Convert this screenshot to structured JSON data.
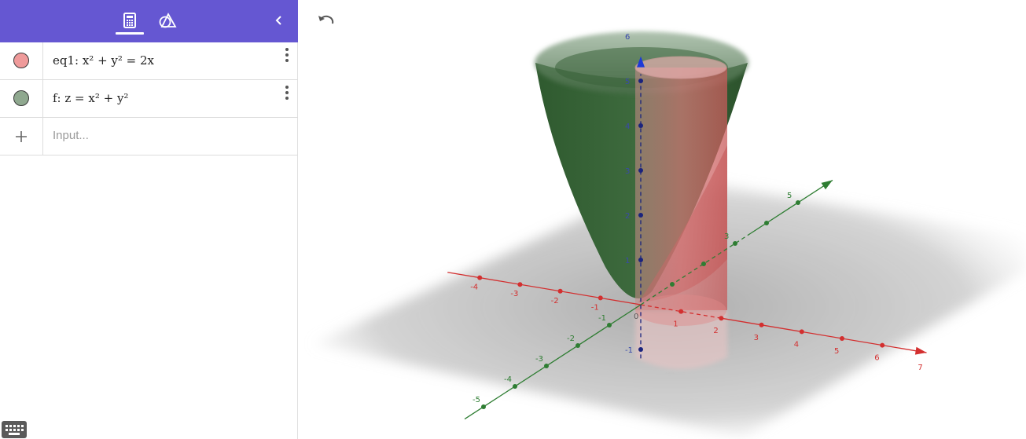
{
  "header": {
    "tabs": [
      {
        "name": "algebra",
        "icon": "calculator-icon",
        "active": true
      },
      {
        "name": "tools",
        "icon": "shapes-icon",
        "active": false
      }
    ],
    "collapse_icon": "chevron-left-icon",
    "accent_color": "#6557d2"
  },
  "algebra": {
    "items": [
      {
        "label": "eq1: x² + y² = 2x",
        "color": "#ef9a9a"
      },
      {
        "label": "f: z = x² + y²",
        "color": "#8fa88f"
      }
    ],
    "input": {
      "placeholder": "Input..."
    }
  },
  "graphics": {
    "x_ticks_neg": [
      "-4",
      "-3",
      "-2",
      "-1"
    ],
    "x_ticks_pos": [
      "1",
      "2",
      "3",
      "4",
      "5",
      "6",
      "7"
    ],
    "y_ticks_neg": [
      "-5",
      "-4",
      "-3",
      "-2",
      "-1"
    ],
    "y_ticks_pos": [
      "3",
      "5"
    ],
    "z_ticks": [
      "6",
      "5",
      "4",
      "3",
      "2",
      "1",
      "-1"
    ],
    "origin": "0",
    "x_axis_color": "#d32f2f",
    "y_axis_color": "#2e7d32",
    "z_axis_color": "#1a237e"
  }
}
